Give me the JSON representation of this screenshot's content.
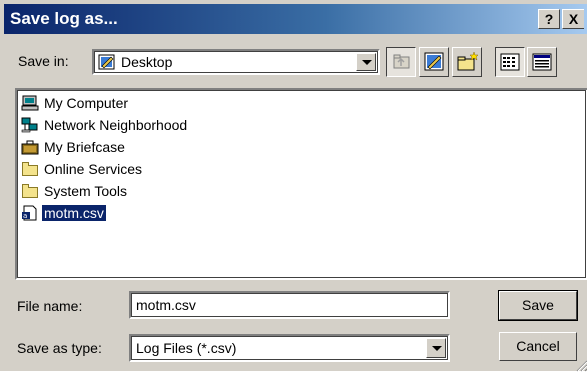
{
  "window": {
    "title": "Save log as...",
    "help_label": "?",
    "close_label": "X"
  },
  "save_in": {
    "label": "Save in:",
    "value": "Desktop"
  },
  "toolbar": {
    "buttons": [
      "up-one-level",
      "desktop",
      "create-new-folder",
      "list-view",
      "details-view"
    ]
  },
  "files": [
    {
      "name": "My Computer",
      "icon": "computer-icon"
    },
    {
      "name": "Network Neighborhood",
      "icon": "network-icon"
    },
    {
      "name": "My Briefcase",
      "icon": "briefcase-icon"
    },
    {
      "name": "Online Services",
      "icon": "folder-icon"
    },
    {
      "name": "System Tools",
      "icon": "folder-icon"
    },
    {
      "name": "motm.csv",
      "icon": "csv-file-icon",
      "selected": true
    }
  ],
  "file_name": {
    "label": "File name:",
    "value": "motm.csv"
  },
  "save_as_type": {
    "label": "Save as type:",
    "value": "Log Files (*.csv)"
  },
  "buttons": {
    "save": "Save",
    "cancel": "Cancel"
  },
  "colors": {
    "titlebar_start": "#0a246a",
    "titlebar_end": "#a6caf0",
    "face": "#d4d0c8",
    "selection": "#0a246a"
  }
}
